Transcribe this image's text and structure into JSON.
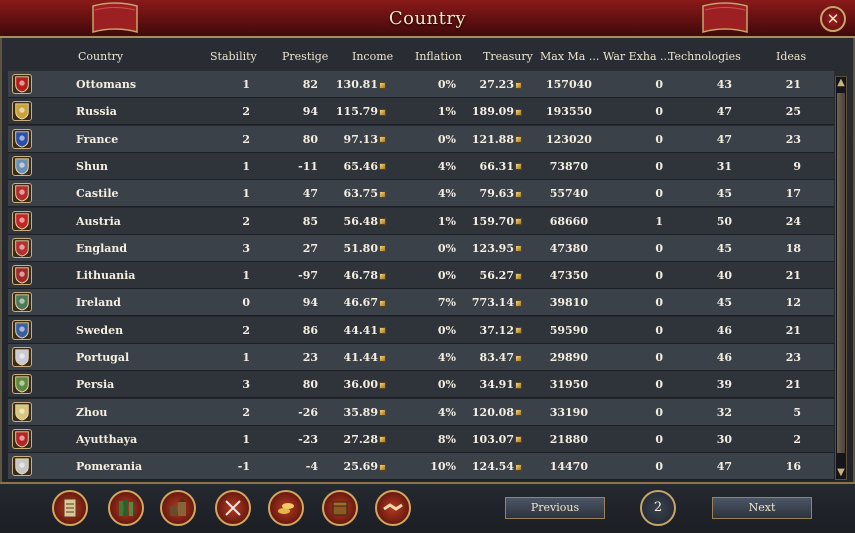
{
  "window": {
    "title": "Country",
    "close_glyph": "✕"
  },
  "columns": [
    "Country",
    "Stability",
    "Prestige",
    "Income",
    "Inflation",
    "Treasury",
    "Max Ma ...",
    "War Exha ...",
    "Technologies",
    "Ideas"
  ],
  "rows": [
    {
      "country": "Ottomans",
      "stability": "1",
      "prestige": "82",
      "income": "130.81",
      "inflation": "0%",
      "treasury": "27.23",
      "max_manpower": "157040",
      "war_exhaustion": "0",
      "technologies": "43",
      "ideas": "21",
      "flag_color": "#b51d1d",
      "flag_icon": "crescent-icon"
    },
    {
      "country": "Russia",
      "stability": "2",
      "prestige": "94",
      "income": "115.79",
      "inflation": "1%",
      "treasury": "189.09",
      "max_manpower": "193550",
      "war_exhaustion": "0",
      "technologies": "47",
      "ideas": "25",
      "flag_color": "#c9a33a",
      "flag_icon": "eagle-icon"
    },
    {
      "country": "France",
      "stability": "2",
      "prestige": "80",
      "income": "97.13",
      "inflation": "0%",
      "treasury": "121.88",
      "max_manpower": "123020",
      "war_exhaustion": "0",
      "technologies": "47",
      "ideas": "23",
      "flag_color": "#2a4fa8",
      "flag_icon": "fleur-icon"
    },
    {
      "country": "Shun",
      "stability": "1",
      "prestige": "-11",
      "income": "65.46",
      "inflation": "4%",
      "treasury": "66.31",
      "max_manpower": "73870",
      "war_exhaustion": "0",
      "technologies": "31",
      "ideas": "9",
      "flag_color": "#6e8fb4",
      "flag_icon": "stripes-icon"
    },
    {
      "country": "Castile",
      "stability": "1",
      "prestige": "47",
      "income": "63.75",
      "inflation": "4%",
      "treasury": "79.63",
      "max_manpower": "55740",
      "war_exhaustion": "0",
      "technologies": "45",
      "ideas": "17",
      "flag_color": "#b52b2b",
      "flag_icon": "castle-icon"
    },
    {
      "country": "Austria",
      "stability": "2",
      "prestige": "85",
      "income": "56.48",
      "inflation": "1%",
      "treasury": "159.70",
      "max_manpower": "68660",
      "war_exhaustion": "1",
      "technologies": "50",
      "ideas": "24",
      "flag_color": "#c32424",
      "flag_icon": "bar-icon"
    },
    {
      "country": "England",
      "stability": "3",
      "prestige": "27",
      "income": "51.80",
      "inflation": "0%",
      "treasury": "123.95",
      "max_manpower": "47380",
      "war_exhaustion": "0",
      "technologies": "45",
      "ideas": "18",
      "flag_color": "#b23030",
      "flag_icon": "quarters-icon"
    },
    {
      "country": "Lithuania",
      "stability": "1",
      "prestige": "-97",
      "income": "46.78",
      "inflation": "0%",
      "treasury": "56.27",
      "max_manpower": "47350",
      "war_exhaustion": "0",
      "technologies": "40",
      "ideas": "21",
      "flag_color": "#a02a2a",
      "flag_icon": "knight-icon"
    },
    {
      "country": "Ireland",
      "stability": "0",
      "prestige": "94",
      "income": "46.67",
      "inflation": "7%",
      "treasury": "773.14",
      "max_manpower": "39810",
      "war_exhaustion": "0",
      "technologies": "45",
      "ideas": "12",
      "flag_color": "#4f7a58",
      "flag_icon": "harp-icon"
    },
    {
      "country": "Sweden",
      "stability": "2",
      "prestige": "86",
      "income": "44.41",
      "inflation": "0%",
      "treasury": "37.12",
      "max_manpower": "59590",
      "war_exhaustion": "0",
      "technologies": "46",
      "ideas": "21",
      "flag_color": "#3a5fa0",
      "flag_icon": "crowns-icon"
    },
    {
      "country": "Portugal",
      "stability": "1",
      "prestige": "23",
      "income": "41.44",
      "inflation": "4%",
      "treasury": "83.47",
      "max_manpower": "29890",
      "war_exhaustion": "0",
      "technologies": "46",
      "ideas": "23",
      "flag_color": "#c9c9d8",
      "flag_icon": "cross-icon"
    },
    {
      "country": "Persia",
      "stability": "3",
      "prestige": "80",
      "income": "36.00",
      "inflation": "0%",
      "treasury": "34.91",
      "max_manpower": "31950",
      "war_exhaustion": "0",
      "technologies": "39",
      "ideas": "21",
      "flag_color": "#5c8a3c",
      "flag_icon": "lion-icon"
    },
    {
      "country": "Zhou",
      "stability": "2",
      "prestige": "-26",
      "income": "35.89",
      "inflation": "4%",
      "treasury": "120.08",
      "max_manpower": "33190",
      "war_exhaustion": "0",
      "technologies": "32",
      "ideas": "5",
      "flag_color": "#d6c57a",
      "flag_icon": "stripes-icon"
    },
    {
      "country": "Ayutthaya",
      "stability": "1",
      "prestige": "-23",
      "income": "27.28",
      "inflation": "8%",
      "treasury": "103.07",
      "max_manpower": "21880",
      "war_exhaustion": "0",
      "technologies": "30",
      "ideas": "2",
      "flag_color": "#b52424",
      "flag_icon": "elephant-icon"
    },
    {
      "country": "Pomerania",
      "stability": "-1",
      "prestige": "-4",
      "income": "25.69",
      "inflation": "10%",
      "treasury": "124.54",
      "max_manpower": "14470",
      "war_exhaustion": "0",
      "technologies": "47",
      "ideas": "16",
      "flag_color": "#c6c6c6",
      "flag_icon": "griffin-icon"
    }
  ],
  "toolbar": {
    "tools": [
      {
        "name": "ledger-scroll-icon"
      },
      {
        "name": "books-icon"
      },
      {
        "name": "buildings-icon"
      },
      {
        "name": "crossed-swords-icon"
      },
      {
        "name": "coins-icon"
      },
      {
        "name": "treasure-chest-icon"
      },
      {
        "name": "handshake-icon"
      }
    ],
    "previous_label": "Previous",
    "page": "2",
    "next_label": "Next"
  },
  "colors": {
    "title_red": "#6e1213",
    "gold_trim": "#c6a46a",
    "row_odd": "#3b4149",
    "row_even": "#2f343b"
  }
}
